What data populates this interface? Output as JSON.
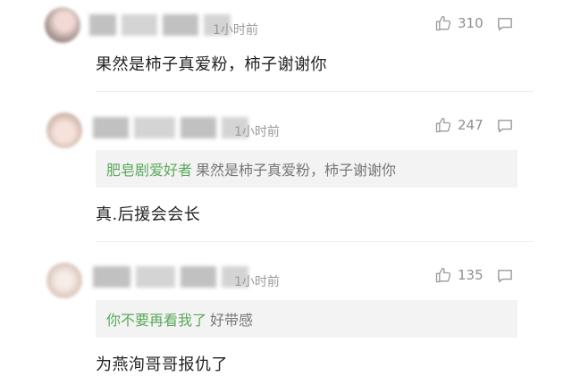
{
  "comments": [
    {
      "time": "1小时前",
      "likes": "310",
      "text": "果然是柿子真爱粉，柿子谢谢你",
      "avatar_icon": "user-avatar-blurred",
      "like_icon": "thumbs-up-icon",
      "reply_icon": "comment-icon"
    },
    {
      "time": "1小时前",
      "likes": "247",
      "quote_name": "肥皂剧爱好者",
      "quote_text": "果然是柿子真爱粉，柿子谢谢你",
      "text": "真.后援会会长",
      "avatar_icon": "user-avatar-blurred",
      "like_icon": "thumbs-up-icon",
      "reply_icon": "comment-icon"
    },
    {
      "time": "1小时前",
      "likes": "135",
      "quote_name": "你不要再看我了",
      "quote_text": "好带感",
      "text": "为燕洵哥哥报仇了",
      "avatar_icon": "user-avatar-blurred",
      "like_icon": "thumbs-up-icon",
      "reply_icon": "comment-icon"
    }
  ],
  "colors": {
    "quote_name": "#5aa95c",
    "meta_gray": "#9a9a9a",
    "quote_bg": "#f3f3f3"
  }
}
